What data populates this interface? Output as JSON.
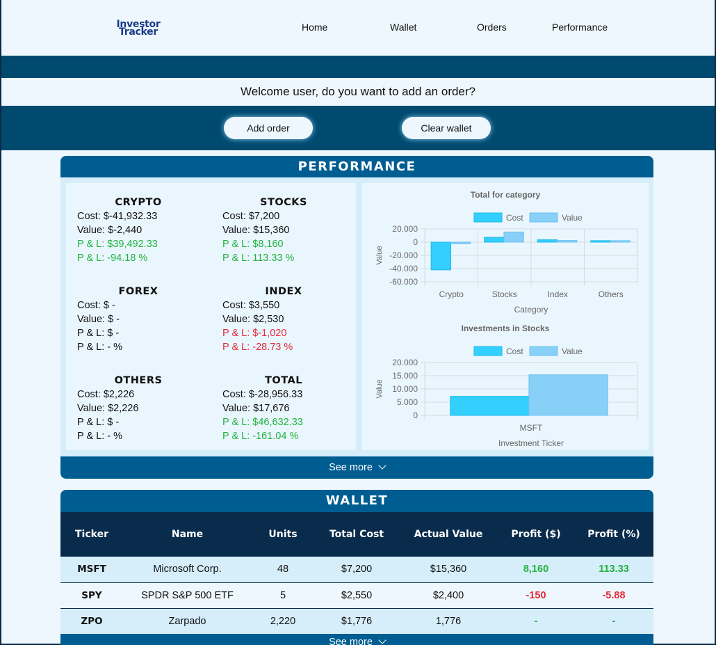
{
  "logo": {
    "line1": "Investor",
    "line2": "Tracker"
  },
  "nav": {
    "home": "Home",
    "wallet": "Wallet",
    "orders": "Orders",
    "performance": "Performance"
  },
  "welcome": "Welcome user, do you want to add an order?",
  "buttons": {
    "add_order": "Add order",
    "clear_wallet": "Clear wallet"
  },
  "performance": {
    "title": "PERFORMANCE",
    "see_more": "See more",
    "categories": [
      {
        "name": "CRYPTO",
        "cost": "Cost: $-41,932.33",
        "value": "Value: $-2,440",
        "pl": "P & L: $39,492.33",
        "pl_pct": "P & L: -94.18 %",
        "pl_color": "green"
      },
      {
        "name": "STOCKS",
        "cost": "Cost: $7,200",
        "value": "Value: $15,360",
        "pl": "P & L: $8,160",
        "pl_pct": "P & L: 113.33 %",
        "pl_color": "green"
      },
      {
        "name": "FOREX",
        "cost": "Cost: $ -",
        "value": "Value: $ -",
        "pl": "P & L: $ -",
        "pl_pct": "P & L: - %",
        "pl_color": "neutral"
      },
      {
        "name": "INDEX",
        "cost": "Cost: $3,550",
        "value": "Value: $2,530",
        "pl": "P & L: $-1,020",
        "pl_pct": "P & L: -28.73 %",
        "pl_color": "red"
      },
      {
        "name": "OTHERS",
        "cost": "Cost: $2,226",
        "value": "Value: $2,226",
        "pl": "P & L: $ -",
        "pl_pct": "P & L: - %",
        "pl_color": "neutral"
      },
      {
        "name": "TOTAL",
        "cost": "Cost: $-28,956.33",
        "value": "Value: $17,676",
        "pl": "P & L: $46,632.33",
        "pl_pct": "P & L: -161.04 %",
        "pl_color": "green"
      }
    ]
  },
  "colors": {
    "cost": "#33d0ff",
    "value": "#88d0f8",
    "green": "#20b33e",
    "red": "#e22b3b",
    "navy": "#00496f"
  },
  "chart_data": [
    {
      "type": "bar",
      "title": "Total for category",
      "xlabel": "Category",
      "ylabel": "Value",
      "categories": [
        "Crypto",
        "Stocks",
        "Index",
        "Others"
      ],
      "series": [
        {
          "name": "Cost",
          "values": [
            -41932.33,
            7200,
            3550,
            2226
          ]
        },
        {
          "name": "Value",
          "values": [
            -2440,
            15360,
            2530,
            2226
          ]
        }
      ],
      "ylim": [
        -60000,
        20000
      ],
      "yticks": [
        "20.000",
        "0",
        "-20.000",
        "-40.000",
        "-60.000"
      ],
      "legend": "top"
    },
    {
      "type": "bar",
      "title": "Investments in Stocks",
      "xlabel": "Investment Ticker",
      "ylabel": "Value",
      "categories": [
        "MSFT"
      ],
      "series": [
        {
          "name": "Cost",
          "values": [
            7200
          ]
        },
        {
          "name": "Value",
          "values": [
            15360
          ]
        }
      ],
      "ylim": [
        0,
        20000
      ],
      "yticks": [
        "20.000",
        "15.000",
        "10.000",
        "5.000",
        "0"
      ],
      "legend": "top"
    }
  ],
  "wallet": {
    "title": "WALLET",
    "see_more": "See more",
    "headers": [
      "Ticker",
      "Name",
      "Units",
      "Total Cost",
      "Actual Value",
      "Profit ($)",
      "Profit (%)"
    ],
    "rows": [
      {
        "ticker": "MSFT",
        "name": "Microsoft Corp.",
        "units": "48",
        "total_cost": "$7,200",
        "actual_value": "$15,360",
        "profit": "8,160",
        "profit_pct": "113.33",
        "tone": "green"
      },
      {
        "ticker": "SPY",
        "name": "SPDR S&P 500 ETF",
        "units": "5",
        "total_cost": "$2,550",
        "actual_value": "$2,400",
        "profit": "-150",
        "profit_pct": "-5.88",
        "tone": "red"
      },
      {
        "ticker": "ZPO",
        "name": "Zarpado",
        "units": "2,220",
        "total_cost": "$1,776",
        "actual_value": "1,776",
        "profit": "-",
        "profit_pct": "-",
        "tone": "green"
      }
    ]
  }
}
